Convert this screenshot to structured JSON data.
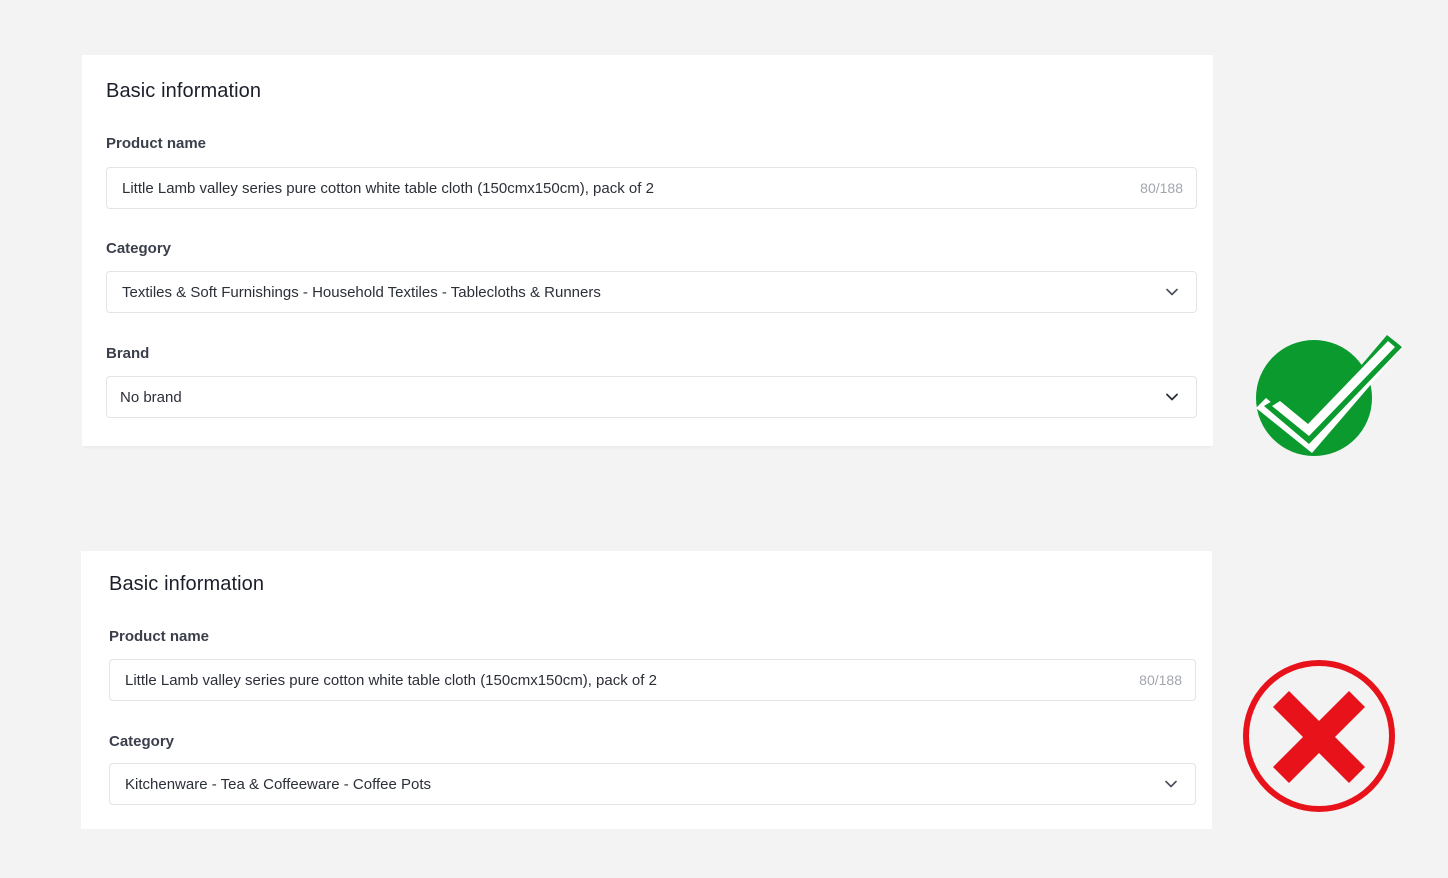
{
  "good_example": {
    "title": "Basic information",
    "product_name": {
      "label": "Product name",
      "value": "Little Lamb valley series pure cotton white table cloth (150cmx150cm), pack of 2",
      "counter": "80/188"
    },
    "category": {
      "label": "Category",
      "value": "Textiles & Soft Furnishings - Household Textiles - Tablecloths & Runners"
    },
    "brand": {
      "label": "Brand",
      "value": "No brand"
    },
    "verdict_icon": "green-checkmark-icon",
    "verdict_color": "#0a9a2e"
  },
  "bad_example": {
    "title": "Basic information",
    "product_name": {
      "label": "Product name",
      "value": "Little Lamb valley series pure cotton white table cloth (150cmx150cm), pack of 2",
      "counter": "80/188"
    },
    "category": {
      "label": "Category",
      "value": "Kitchenware - Tea & Coffeeware - Coffee Pots"
    },
    "verdict_icon": "red-cross-icon",
    "verdict_color": "#e8121a"
  },
  "colors": {
    "background": "#f3f3f3",
    "card": "#ffffff",
    "border": "#e2e4e8",
    "counter_text": "#a2a6ad"
  }
}
